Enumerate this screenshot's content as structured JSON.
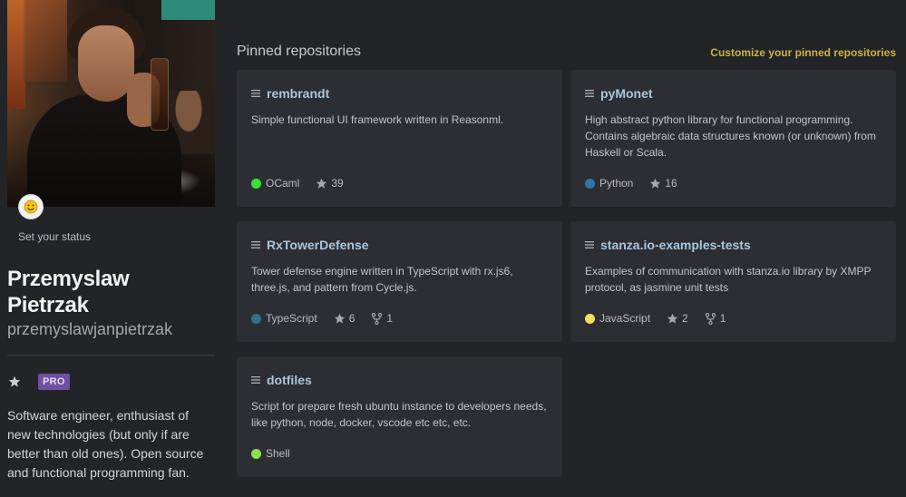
{
  "sidebar": {
    "set_status_label": "Set your status",
    "full_name": "Przemyslaw Pietrzak",
    "username": "przemyslawjanpietrzak",
    "badge": "PRO",
    "bio": "Software engineer, enthusiast of new technologies (but only if are better than old ones). Open source and functional programming fan.",
    "status_icon": "smiley-icon",
    "highlight_icon": "star-icon"
  },
  "main": {
    "section_title": "Pinned repositories",
    "customize_link": "Customize your pinned repositories",
    "accent_color": "#c9b43e",
    "repos": [
      {
        "name": "rembrandt",
        "description": "Simple functional UI framework written in Reasonml.",
        "language": "OCaml",
        "language_color": "#3be133",
        "stars": "39",
        "forks": ""
      },
      {
        "name": "pyMonet",
        "description": "High abstract python library for functional programming. Contains algebraic data structures known (or unknown) from Haskell or Scala.",
        "language": "Python",
        "language_color": "#3572a5",
        "stars": "16",
        "forks": ""
      },
      {
        "name": "RxTowerDefense",
        "description": "Tower defense engine written in TypeScript with rx.js6, three.js, and pattern from Cycle.js.",
        "language": "TypeScript",
        "language_color": "#2b7489",
        "stars": "6",
        "forks": "1"
      },
      {
        "name": "stanza.io-examples-tests",
        "description": "Examples of communication with stanza.io library by XMPP protocol, as jasmine unit tests",
        "language": "JavaScript",
        "language_color": "#f1e05a",
        "stars": "2",
        "forks": "1"
      },
      {
        "name": "dotfiles",
        "description": "Script for prepare fresh ubuntu instance to developers needs, like python, node, docker, vscode etc etc, etc.",
        "language": "Shell",
        "language_color": "#89e051",
        "stars": "",
        "forks": ""
      }
    ]
  }
}
